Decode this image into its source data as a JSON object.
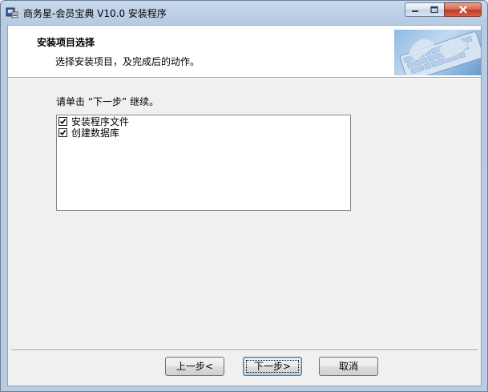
{
  "window": {
    "title": "商务星-会员宝典 V10.0 安装程序"
  },
  "header": {
    "title": "安装项目选择",
    "subtitle": "选择安装项目，及完成后的动作。"
  },
  "main": {
    "instruction": "请单击 “下一步” 继续。",
    "items": [
      {
        "label": "安装程序文件",
        "checked": true
      },
      {
        "label": "创建数据库",
        "checked": true
      }
    ]
  },
  "buttons": {
    "back": "上一步<",
    "next": "下一步>",
    "cancel": "取消"
  },
  "icons": {
    "app": "installer-icon",
    "minimize": "minimize-icon",
    "maximize": "maximize-icon",
    "close": "close-icon",
    "header_image": "keyboard-hands-image"
  }
}
